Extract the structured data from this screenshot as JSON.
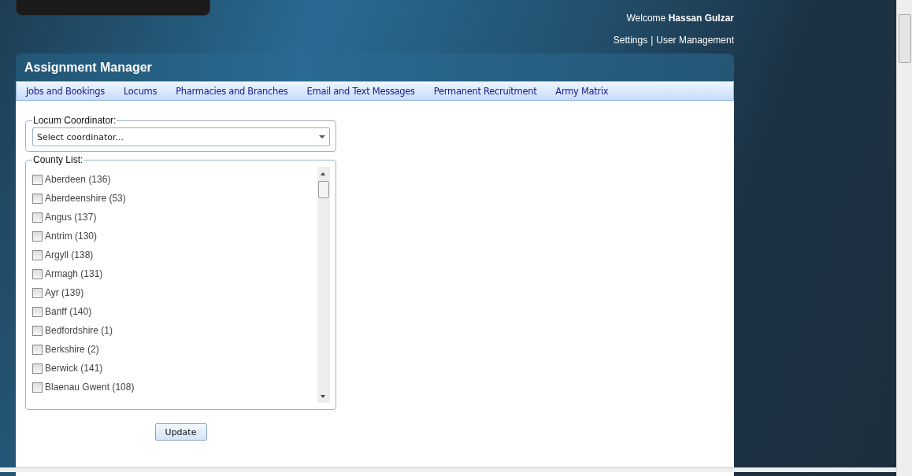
{
  "header": {
    "welcome": "Welcome **Hassan Gulzar**",
    "links": [
      "Settings",
      "User Management"
    ],
    "separator": "|"
  },
  "panel": {
    "title": "Assignment Manager"
  },
  "tabs": [
    {
      "label": "Jobs and Bookings"
    },
    {
      "label": "Locums"
    },
    {
      "label": "Pharmacies and Branches"
    },
    {
      "label": "Email and Text Messages"
    },
    {
      "label": "Permanent Recruitment"
    },
    {
      "label": "Army Matrix"
    }
  ],
  "coordinator": {
    "legend": "Locum Coordinator:",
    "placeholder": "Select coordinator..."
  },
  "county_list": {
    "legend": "County List:",
    "items": [
      {
        "label": "Aberdeen (136)",
        "checked": false
      },
      {
        "label": "Aberdeenshire (53)",
        "checked": false
      },
      {
        "label": "Angus (137)",
        "checked": false
      },
      {
        "label": "Antrim (130)",
        "checked": false
      },
      {
        "label": "Argyll (138)",
        "checked": false
      },
      {
        "label": "Armagh (131)",
        "checked": false
      },
      {
        "label": "Ayr (139)",
        "checked": false
      },
      {
        "label": "Banff (140)",
        "checked": false
      },
      {
        "label": "Bedfordshire (1)",
        "checked": false
      },
      {
        "label": "Berkshire (2)",
        "checked": false
      },
      {
        "label": "Berwick (141)",
        "checked": false
      },
      {
        "label": "Blaenau Gwent (108)",
        "checked": false
      }
    ]
  },
  "update_button": "Update"
}
